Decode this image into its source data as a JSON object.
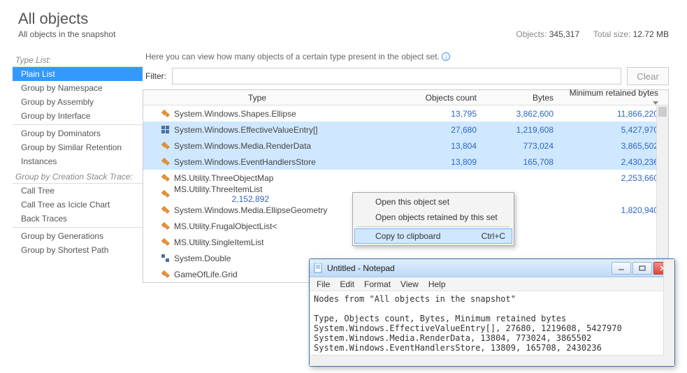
{
  "header": {
    "title": "All objects",
    "subtitle": "All objects in the snapshot",
    "objects_label": "Objects:",
    "objects_value": "345,317",
    "size_label": "Total size:",
    "size_value": "12.72 MB"
  },
  "sidebar": {
    "sec1": "Type List:",
    "items1": [
      "Plain List",
      "Group by Namespace",
      "Group by Assembly",
      "Group by Interface"
    ],
    "items2": [
      "Group by Dominators",
      "Group by Similar Retention",
      "Instances"
    ],
    "sec2": "Group by Creation Stack Trace:",
    "items3": [
      "Call Tree",
      "Call Tree as Icicle Chart",
      "Back Traces"
    ],
    "items4": [
      "Group by Generations",
      "Group by Shortest Path"
    ]
  },
  "content": {
    "hint": "Here you can view how many objects of a certain type present in the object set.",
    "filter_label": "Filter:",
    "clear_label": "Clear"
  },
  "table": {
    "cols": [
      "Type",
      "Objects count",
      "Bytes",
      "Minimum retained bytes"
    ],
    "rows": [
      {
        "icon": "class",
        "type": "System.Windows.Shapes.Ellipse",
        "count": "13,795",
        "bytes": "3,862,600",
        "retained": "11,866,220"
      },
      {
        "icon": "array",
        "type": "System.Windows.EffectiveValueEntry[]",
        "count": "27,680",
        "bytes": "1,219,608",
        "retained": "5,427,970",
        "sel": true
      },
      {
        "icon": "class",
        "type": "System.Windows.Media.RenderData",
        "count": "13,804",
        "bytes": "773,024",
        "retained": "3,865,502",
        "sel": true
      },
      {
        "icon": "class",
        "type": "System.Windows.EventHandlersStore",
        "count": "13,809",
        "bytes": "165,708",
        "retained": "2,430,236",
        "sel": true
      },
      {
        "icon": "class",
        "type": "MS.Utility.ThreeObjectMap",
        "count": "",
        "bytes": "",
        "retained": "2,253,660"
      },
      {
        "icon": "class",
        "type": "MS.Utility.ThreeItemList<Object>",
        "count": "",
        "bytes": "",
        "retained": "2,152,892"
      },
      {
        "icon": "class",
        "type": "System.Windows.Media.EllipseGeometry",
        "count": "",
        "bytes": "",
        "retained": "1,820,940"
      },
      {
        "icon": "class",
        "type": "MS.Utility.FrugalObjectList<",
        "count": "",
        "bytes": "",
        "retained": ""
      },
      {
        "icon": "class",
        "type": "MS.Utility.SingleItemList<Ro",
        "count": "",
        "bytes": "",
        "retained": ""
      },
      {
        "icon": "struct",
        "type": "System.Double",
        "count": "",
        "bytes": "",
        "retained": ""
      },
      {
        "icon": "class",
        "type": "GameOfLife.Grid",
        "count": "",
        "bytes": "",
        "retained": ""
      }
    ]
  },
  "ctx": {
    "open_set": "Open this object set",
    "open_retained": "Open objects retained by this set",
    "copy": "Copy to clipboard",
    "copy_key": "Ctrl+C"
  },
  "notepad": {
    "title": "Untitled - Notepad",
    "menu": [
      "File",
      "Edit",
      "Format",
      "View",
      "Help"
    ],
    "text": "Nodes from \"All objects in the snapshot\"\n\nType, Objects count, Bytes, Minimum retained bytes\nSystem.Windows.EffectiveValueEntry[], 27680, 1219608, 5427970\nSystem.Windows.Media.RenderData, 13804, 773024, 3865502\nSystem.Windows.EventHandlersStore, 13809, 165708, 2430236"
  }
}
